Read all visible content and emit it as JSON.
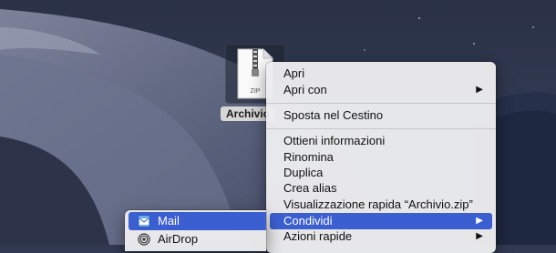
{
  "file": {
    "label": "Archivio",
    "badge": "ZIP"
  },
  "menu": {
    "items": [
      {
        "label": "Apri",
        "submenu": false
      },
      {
        "label": "Apri con",
        "submenu": true
      },
      {
        "label": "Sposta nel Cestino",
        "submenu": false
      },
      {
        "label": "Ottieni informazioni",
        "submenu": false
      },
      {
        "label": "Rinomina",
        "submenu": false
      },
      {
        "label": "Duplica",
        "submenu": false
      },
      {
        "label": "Crea alias",
        "submenu": false
      },
      {
        "label": "Visualizzazione rapida “Archivio.zip”",
        "submenu": false
      },
      {
        "label": "Condividi",
        "submenu": true,
        "selected": true
      },
      {
        "label": "Azioni rapide",
        "submenu": true
      }
    ],
    "submenu_arrow": "▶"
  },
  "share_menu": {
    "items": [
      {
        "label": "Mail",
        "icon": "mail-icon",
        "selected": true
      },
      {
        "label": "AirDrop",
        "icon": "airdrop-icon"
      }
    ]
  },
  "colors": {
    "selection": "#3b5fd0",
    "menu_bg": "#ececee"
  }
}
